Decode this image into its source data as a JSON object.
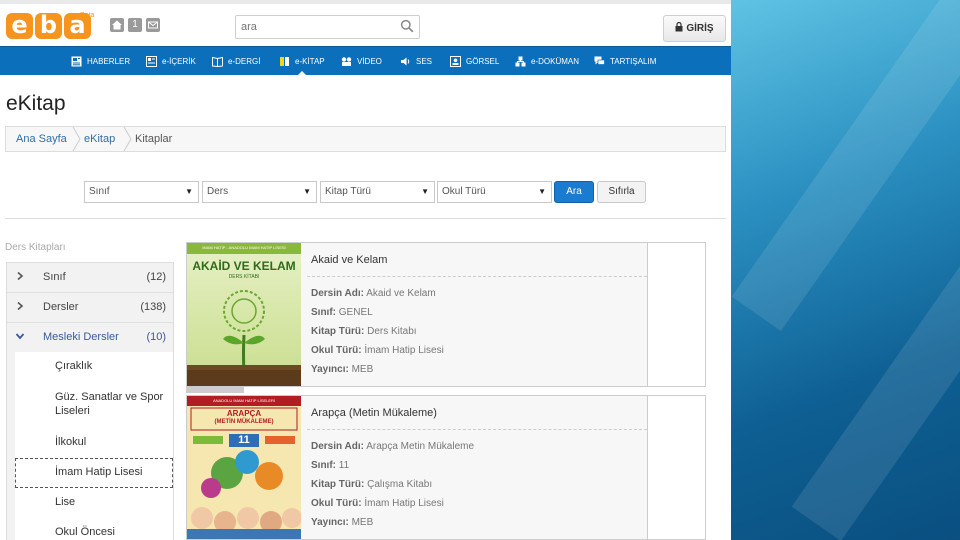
{
  "header": {
    "logo_text": "eba",
    "logo_sub": "Beta",
    "search_placeholder": "ara",
    "login_label": "GİRİŞ",
    "quick_icons": [
      "home-icon",
      "one-icon",
      "mail-icon"
    ],
    "quick_icon_one": "1"
  },
  "nav": {
    "items": [
      {
        "label": "HABERLER",
        "icon": "news-icon"
      },
      {
        "label": "e-İÇERİK",
        "icon": "content-icon"
      },
      {
        "label": "e-DERGİ",
        "icon": "magazine-icon"
      },
      {
        "label": "e-KİTAP",
        "icon": "book-icon",
        "active": true
      },
      {
        "label": "VİDEO",
        "icon": "video-icon"
      },
      {
        "label": "SES",
        "icon": "sound-icon"
      },
      {
        "label": "GÖRSEL",
        "icon": "image-icon"
      },
      {
        "label": "e-DOKÜMAN",
        "icon": "document-icon"
      },
      {
        "label": "TARTIŞALIM",
        "icon": "discussion-icon"
      }
    ]
  },
  "page_title": "eKitap",
  "breadcrumb": [
    "Ana Sayfa",
    "eKitap",
    "Kitaplar"
  ],
  "filters": {
    "selects": [
      "Sınıf",
      "Ders",
      "Kitap Türü",
      "Okul Türü"
    ],
    "search_label": "Ara",
    "reset_label": "Sıfırla"
  },
  "sidebar": {
    "title": "Ders Kitapları",
    "groups": [
      {
        "label": "Sınıf",
        "count": "(12)"
      },
      {
        "label": "Dersler",
        "count": "(138)"
      },
      {
        "label": "Mesleki Dersler",
        "count": "(10)",
        "open": true
      }
    ],
    "subitems": [
      "Çıraklık",
      "Güz. Sanatlar ve Spor Liseleri",
      "İlkokul",
      "İmam Hatip Lisesi",
      "Lise",
      "Okul Öncesi"
    ],
    "selected_subitem": "İmam Hatip Lisesi"
  },
  "books": [
    {
      "title": "Akaid ve Kelam",
      "cover_top": "İMAM HATİP - ANADOLU İMAM HATİP LİSESİ",
      "cover_title": "AKAİD VE KELAM",
      "cover_sub": "DERS KİTABI",
      "fields": [
        {
          "key": "Dersin Adı:",
          "value": "Akaid ve Kelam"
        },
        {
          "key": "Sınıf:",
          "value": "GENEL"
        },
        {
          "key": "Kitap Türü:",
          "value": "Ders Kitabı"
        },
        {
          "key": "Okul Türü:",
          "value": "İmam Hatip Lisesi"
        },
        {
          "key": "Yayıncı:",
          "value": "MEB"
        }
      ]
    },
    {
      "title": "Arapça (Metin Mükaleme)",
      "cover_top": "ANADOLU İMAM HATİP LİSELERİ",
      "cover_title": "ARAPÇA",
      "cover_sub": "(METİN MÜKALEME)",
      "cover_grade": "11",
      "fields": [
        {
          "key": "Dersin Adı:",
          "value": "Arapça Metin Mükaleme"
        },
        {
          "key": "Sınıf:",
          "value": "11"
        },
        {
          "key": "Kitap Türü:",
          "value": "Çalışma Kitabı"
        },
        {
          "key": "Okul Türü:",
          "value": "İmam Hatip Lisesi"
        },
        {
          "key": "Yayıncı:",
          "value": "MEB"
        }
      ]
    }
  ],
  "colors": {
    "nav_blue": "#0c6fbb",
    "logo_orange": "#f7941d",
    "link_blue": "#2d6fa8",
    "button_blue": "#1a7bd0",
    "slide_blue": "#0e5f93"
  }
}
